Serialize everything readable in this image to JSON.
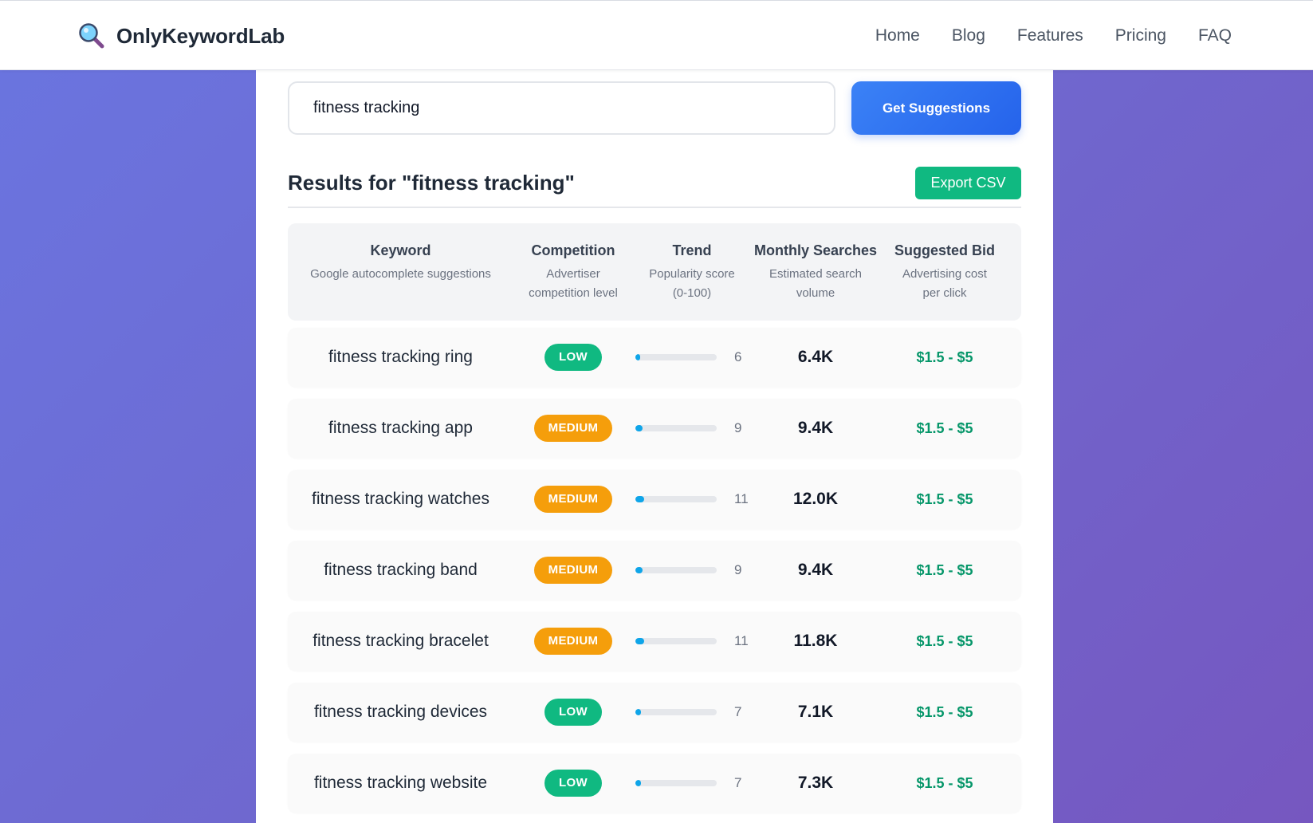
{
  "app": {
    "name": "OnlyKeywordLab",
    "logo_icon": "magnifier-icon"
  },
  "nav": [
    "Home",
    "Blog",
    "Features",
    "Pricing",
    "FAQ"
  ],
  "search": {
    "value": "fitness tracking",
    "button_label": "Get Suggestions"
  },
  "results": {
    "title": "Results for \"fitness tracking\"",
    "export_label": "Export CSV"
  },
  "table": {
    "columns": [
      {
        "title": "Keyword",
        "sub": [
          "Google autocomplete suggestions"
        ]
      },
      {
        "title": "Competition",
        "sub": [
          "Advertiser",
          "competition level"
        ]
      },
      {
        "title": "Trend",
        "sub": [
          "Popularity score",
          "(0-100)"
        ]
      },
      {
        "title": "Monthly Searches",
        "sub": [
          "Estimated search",
          "volume"
        ]
      },
      {
        "title": "Suggested Bid",
        "sub": [
          "Advertising cost",
          "per click"
        ]
      }
    ],
    "rows": [
      {
        "keyword": "fitness tracking ring",
        "competition": "LOW",
        "trend": 6,
        "searches": "6.4K",
        "bid": "$1.5 - $5"
      },
      {
        "keyword": "fitness tracking app",
        "competition": "MEDIUM",
        "trend": 9,
        "searches": "9.4K",
        "bid": "$1.5 - $5"
      },
      {
        "keyword": "fitness tracking watches",
        "competition": "MEDIUM",
        "trend": 11,
        "searches": "12.0K",
        "bid": "$1.5 - $5"
      },
      {
        "keyword": "fitness tracking band",
        "competition": "MEDIUM",
        "trend": 9,
        "searches": "9.4K",
        "bid": "$1.5 - $5"
      },
      {
        "keyword": "fitness tracking bracelet",
        "competition": "MEDIUM",
        "trend": 11,
        "searches": "11.8K",
        "bid": "$1.5 - $5"
      },
      {
        "keyword": "fitness tracking devices",
        "competition": "LOW",
        "trend": 7,
        "searches": "7.1K",
        "bid": "$1.5 - $5"
      },
      {
        "keyword": "fitness tracking website",
        "competition": "LOW",
        "trend": 7,
        "searches": "7.3K",
        "bid": "$1.5 - $5"
      }
    ]
  },
  "colors": {
    "accent_blue": "#2563eb",
    "export_green": "#10b981",
    "low_badge": "#10b981",
    "medium_badge": "#f59e0b",
    "bid_green": "#059669",
    "trend_fill": "#0ea5e9"
  }
}
